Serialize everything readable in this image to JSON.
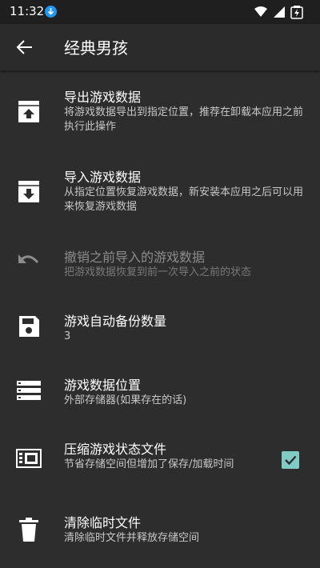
{
  "status_bar": {
    "time": "11:32",
    "download_icon": "download-arrow-icon",
    "icons": [
      "wifi-icon",
      "signal-icon",
      "battery-icon"
    ]
  },
  "toolbar": {
    "back_icon": "arrow-back-icon",
    "title": "经典男孩"
  },
  "items": [
    {
      "icon": "archive-upload-icon",
      "title": "导出游戏数据",
      "subtitle": "将游戏数据导出到指定位置，推荐在卸载本应用之前执行此操作",
      "enabled": true
    },
    {
      "icon": "archive-download-icon",
      "title": "导入游戏数据",
      "subtitle": "从指定位置恢复游戏数据，新安装本应用之后可以用来恢复游戏数据",
      "enabled": true
    },
    {
      "icon": "undo-icon",
      "title": "撤销之前导入的游戏数据",
      "subtitle": "把游戏数据恢复到前一次导入之前的状态",
      "enabled": false
    },
    {
      "icon": "save-icon",
      "title": "游戏自动备份数量",
      "subtitle": "3",
      "enabled": true
    },
    {
      "icon": "storage-list-icon",
      "title": "游戏数据位置",
      "subtitle": "外部存储器(如果存在的话)",
      "enabled": true
    },
    {
      "icon": "sd-card-compress-icon",
      "title": "压缩游戏状态文件",
      "subtitle": "节省存储空间但增加了保存/加载时间",
      "enabled": true,
      "checked": true
    },
    {
      "icon": "trash-icon",
      "title": "清除临时文件",
      "subtitle": "清除临时文件并释放存储空间",
      "enabled": true
    }
  ],
  "colors": {
    "background": "#2d2d2d",
    "status_bar": "#1f1f1f",
    "accent_check": "#80cbc4",
    "download_badge": "#2196f3"
  }
}
